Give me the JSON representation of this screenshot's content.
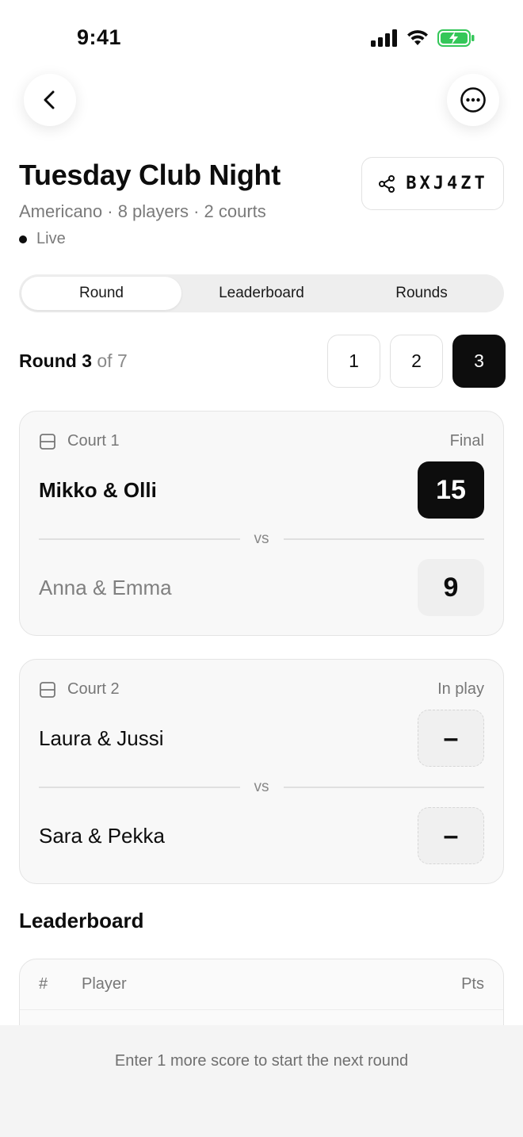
{
  "status_bar": {
    "time": "9:41"
  },
  "header": {
    "title": "Tuesday Club Night",
    "subtitle": "Americano · 8 players · 2 courts",
    "live_label": "Live",
    "session_code": "BXJ4ZT"
  },
  "tabs": [
    {
      "label": "Round",
      "active": true
    },
    {
      "label": "Leaderboard",
      "active": false
    },
    {
      "label": "Rounds",
      "active": false
    }
  ],
  "round": {
    "label": "Round 3",
    "of_label": "of 7",
    "pills": [
      "1",
      "2",
      "3"
    ],
    "active_pill": "3"
  },
  "courts": [
    {
      "name": "Court 1",
      "status": "Final",
      "team_a": {
        "name": "Mikko & Olli",
        "score": "15"
      },
      "vs": "vs",
      "team_b": {
        "name": "Anna & Emma",
        "score": "9"
      }
    },
    {
      "name": "Court 2",
      "status": "In play",
      "team_a": {
        "name": "Laura & Jussi",
        "score": "–"
      },
      "vs": "vs",
      "team_b": {
        "name": "Sara & Pekka",
        "score": "–"
      }
    }
  ],
  "leaderboard": {
    "title": "Leaderboard",
    "columns": {
      "rank": "#",
      "player": "Player",
      "points": "Pts"
    }
  },
  "footer": {
    "message": "Enter 1 more score to start the next round"
  },
  "colors": {
    "accent": "#0d0d0d",
    "battery": "#34c759",
    "muted": "#7a7a7a"
  },
  "icons": [
    "signal-icon",
    "wifi-icon",
    "battery-icon",
    "back-icon",
    "more-icon",
    "share-icon",
    "court-icon"
  ]
}
